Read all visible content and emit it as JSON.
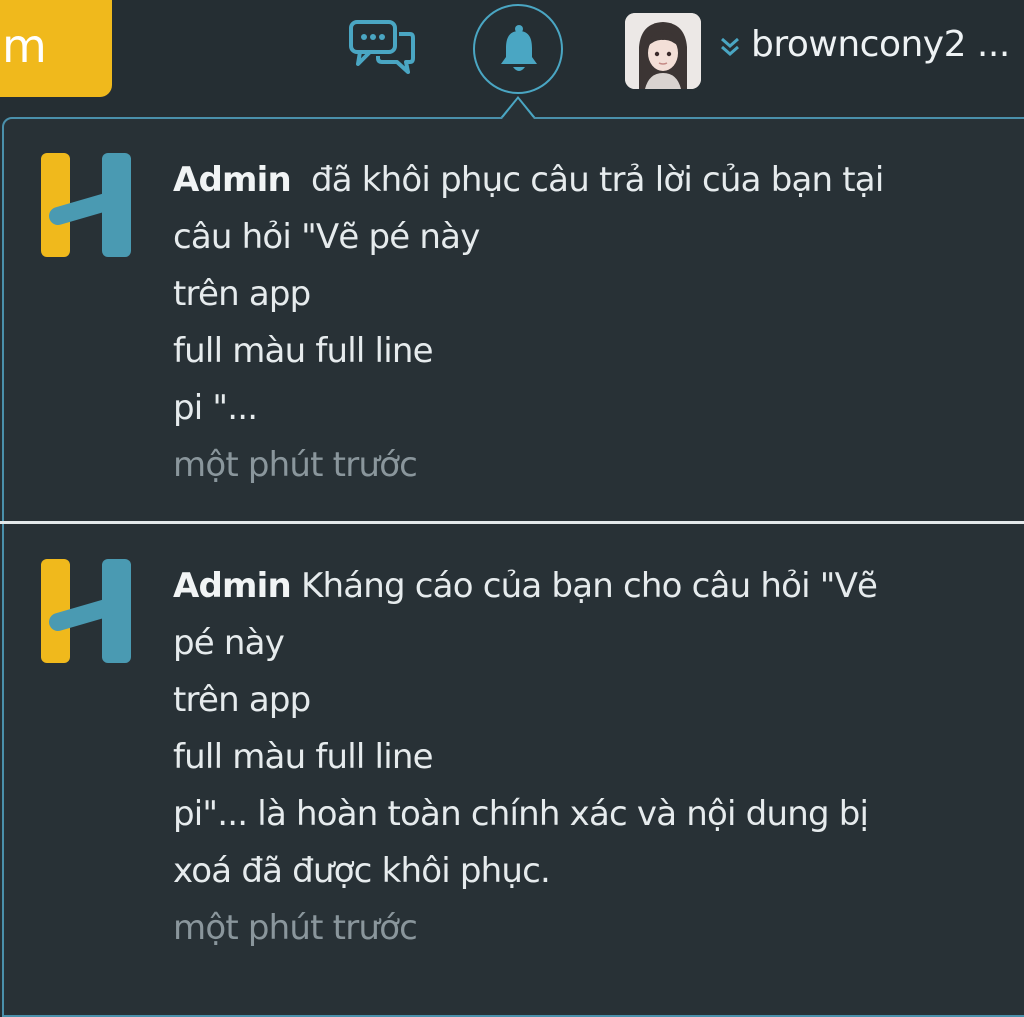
{
  "header": {
    "yellow_button_label": "m",
    "username": "browncony2 ...",
    "icons": {
      "chat": "chat-bubbles-icon",
      "notifications": "bell-icon",
      "dropdown": "double-chevron-down-icon"
    }
  },
  "notifications": [
    {
      "author": "Admin",
      "lines": [
        "đã khôi phục câu trả lời của bạn tại",
        "câu hỏi \"Vẽ pé này",
        "trên app",
        "full màu full line",
        "pi \"..."
      ],
      "time": "một phút trước"
    },
    {
      "author": "Admin",
      "lines": [
        "Kháng cáo của bạn cho câu hỏi \"Vẽ",
        "pé này",
        "trên app",
        "full màu full line",
        "pi\"... là hoàn toàn chính xác và nội dung bị",
        "xoá đã được khôi phục."
      ],
      "time": "một phút trước"
    }
  ],
  "colors": {
    "background": "#252e33",
    "accent_yellow": "#f0b91c",
    "accent_blue": "#4aa6c3",
    "muted_text": "#8a969c"
  }
}
